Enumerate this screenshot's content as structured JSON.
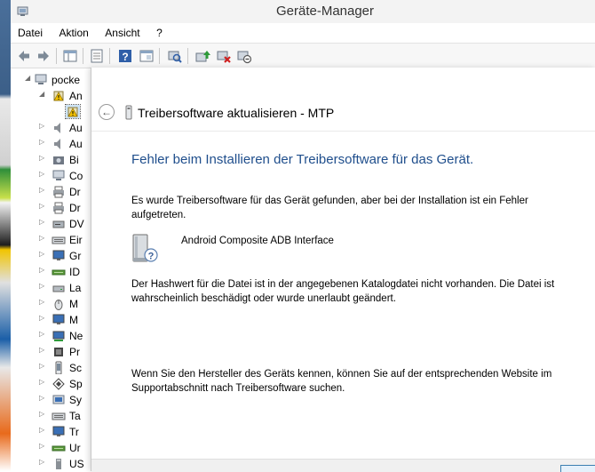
{
  "window": {
    "title": "Geräte-Manager"
  },
  "menu": [
    "Datei",
    "Aktion",
    "Ansicht",
    "?"
  ],
  "toolbar": {
    "buttons": [
      "back-arrow-icon",
      "forward-arrow-icon",
      "tree-view-icon",
      "properties-icon",
      "help-icon",
      "console-icon",
      "scan-hardware-icon",
      "update-driver-icon",
      "uninstall-icon",
      "disable-icon"
    ]
  },
  "tree": {
    "root": "pocke",
    "items": [
      {
        "label": "An",
        "icon": "warning-device-icon",
        "expanded": true
      },
      {
        "label": "",
        "icon": "warning-device-icon",
        "selected": true
      },
      {
        "label": "Au",
        "icon": "speaker-icon"
      },
      {
        "label": "Au",
        "icon": "speaker-icon"
      },
      {
        "label": "Bi",
        "icon": "camera-icon"
      },
      {
        "label": "Co",
        "icon": "computer-icon"
      },
      {
        "label": "Dr",
        "icon": "printer-icon"
      },
      {
        "label": "Dr",
        "icon": "printer-icon"
      },
      {
        "label": "DV",
        "icon": "dvd-drive-icon"
      },
      {
        "label": "Eir",
        "icon": "keyboard-icon"
      },
      {
        "label": "Gr",
        "icon": "monitor-icon"
      },
      {
        "label": "ID",
        "icon": "ide-controller-icon"
      },
      {
        "label": "La",
        "icon": "drive-icon"
      },
      {
        "label": "M",
        "icon": "mouse-icon"
      },
      {
        "label": "M",
        "icon": "monitor-icon"
      },
      {
        "label": "Ne",
        "icon": "network-icon"
      },
      {
        "label": "Pr",
        "icon": "processor-icon"
      },
      {
        "label": "Sc",
        "icon": "phone-icon"
      },
      {
        "label": "Sp",
        "icon": "storage-icon"
      },
      {
        "label": "Sy",
        "icon": "system-icon"
      },
      {
        "label": "Ta",
        "icon": "keyboard-icon"
      },
      {
        "label": "Tr",
        "icon": "monitor-icon"
      },
      {
        "label": "Ur",
        "icon": "controller-icon"
      },
      {
        "label": "US",
        "icon": "usb-icon"
      }
    ]
  },
  "dialog": {
    "title": "Treibersoftware aktualisieren - MTP",
    "heading": "Fehler beim Installieren der Treibersoftware für das Gerät.",
    "text1_line1": "Es wurde Treibersoftware für das Gerät gefunden, aber bei der Installation ist ein Fehler",
    "text1_line2": "aufgetreten.",
    "device_name": "Android Composite ADB Interface",
    "text2_line1": "Der Hashwert für die Datei ist in der angegebenen Katalogdatei nicht vorhanden. Die Datei ist",
    "text2_line2": "wahrscheinlich beschädigt oder wurde unerlaubt geändert.",
    "text3_line1": "Wenn Sie den Hersteller des Geräts kennen, können Sie auf der entsprechenden Website im",
    "text3_line2": "Supportabschnitt nach Treibersoftware suchen."
  },
  "colors": {
    "heading": "#1f4e8c",
    "selection": "#cde4f7"
  }
}
